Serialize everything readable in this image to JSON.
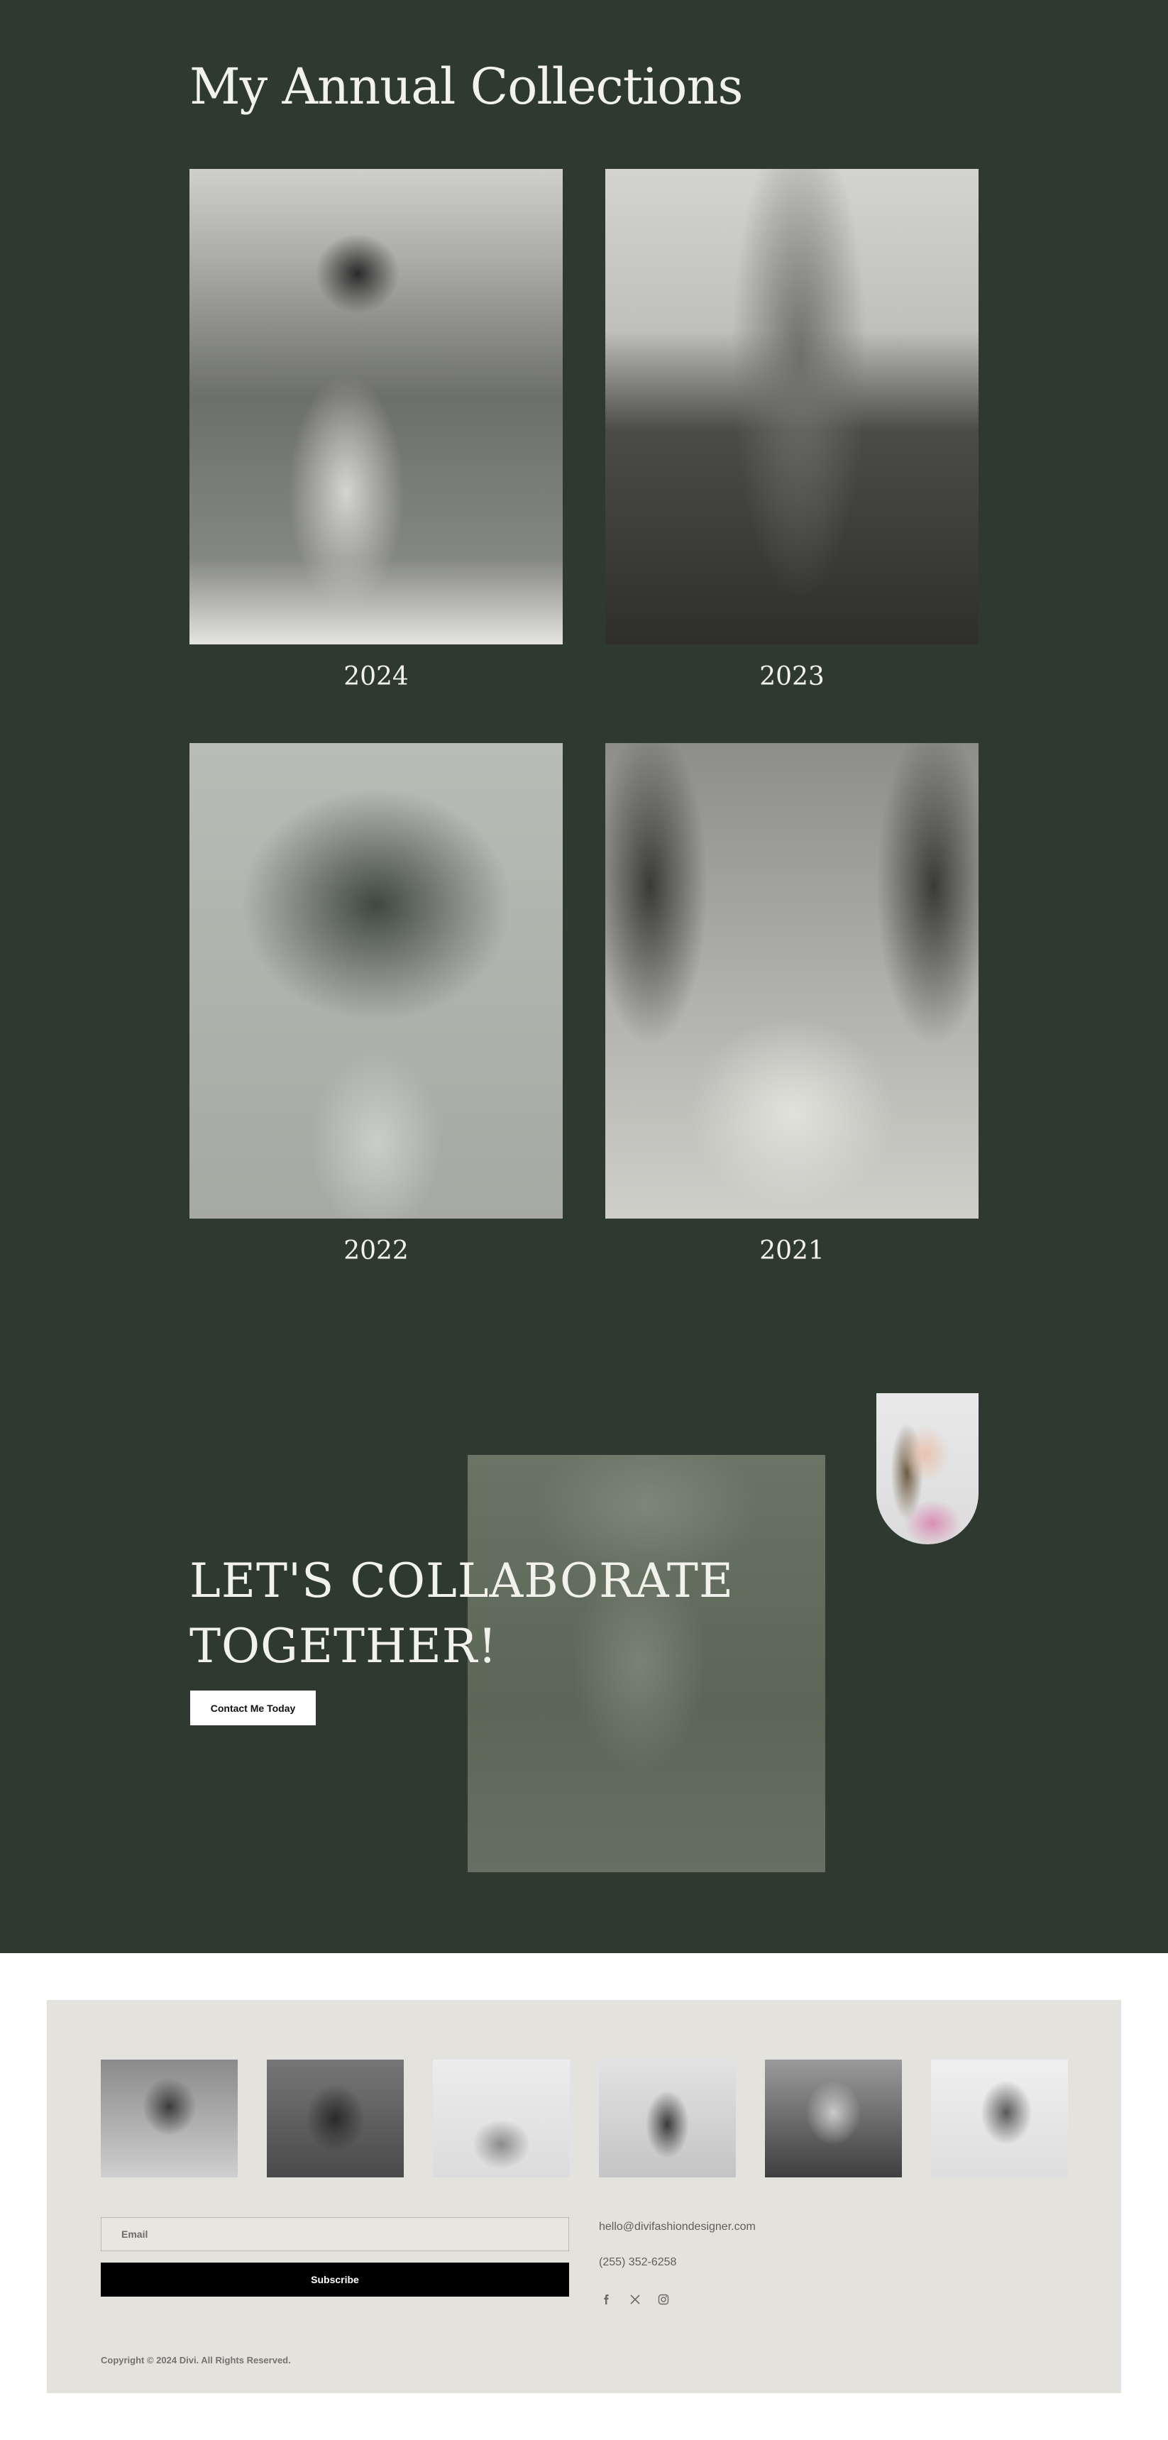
{
  "collections": {
    "title": "My Annual Collections",
    "items": [
      {
        "year": "2024"
      },
      {
        "year": "2023"
      },
      {
        "year": "2022"
      },
      {
        "year": "2021"
      }
    ]
  },
  "collaborate": {
    "heading_line1": "LET'S COLLABORATE",
    "heading_line2": "TOGETHER!",
    "button_label": "Contact Me Today"
  },
  "footer": {
    "email_placeholder": "Email",
    "subscribe_label": "Subscribe",
    "contact_email": "hello@divifashiondesigner.com",
    "contact_phone": "(255) 352-6258",
    "social_icons": [
      "facebook-icon",
      "x-icon",
      "instagram-icon"
    ],
    "copyright": "Copyright © 2024 Divi. All Rights Reserved."
  },
  "colors": {
    "background_dark": "#2e3a2f",
    "footer_background": "#e4e2dd",
    "button_dark": "#000000",
    "button_light": "#ffffff"
  }
}
